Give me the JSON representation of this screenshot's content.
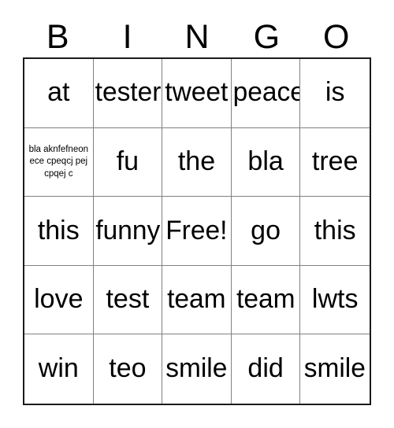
{
  "header": {
    "letters": [
      "B",
      "I",
      "N",
      "G",
      "O"
    ]
  },
  "grid": {
    "rows": [
      {
        "cells": [
          {
            "text": "at"
          },
          {
            "text": "tester"
          },
          {
            "text": "tweet"
          },
          {
            "text": "peace"
          },
          {
            "text": "is"
          }
        ]
      },
      {
        "cells": [
          {
            "text": "bla aknfefneon ece cpeqcj pej cpqej c"
          },
          {
            "text": "fu"
          },
          {
            "text": "the"
          },
          {
            "text": "bla"
          },
          {
            "text": "tree"
          }
        ]
      },
      {
        "cells": [
          {
            "text": "this"
          },
          {
            "text": "funny"
          },
          {
            "text": "Free!"
          },
          {
            "text": "go"
          },
          {
            "text": "this"
          }
        ]
      },
      {
        "cells": [
          {
            "text": "love"
          },
          {
            "text": "test"
          },
          {
            "text": "team"
          },
          {
            "text": "team"
          },
          {
            "text": "lwts"
          }
        ]
      },
      {
        "cells": [
          {
            "text": "win"
          },
          {
            "text": "teo"
          },
          {
            "text": "smile"
          },
          {
            "text": "did"
          },
          {
            "text": "smile"
          }
        ]
      }
    ]
  },
  "colors": {
    "background": "#ffffff",
    "text": "#000000",
    "outer_border": "#1a1a1a",
    "inner_border": "#808080"
  }
}
